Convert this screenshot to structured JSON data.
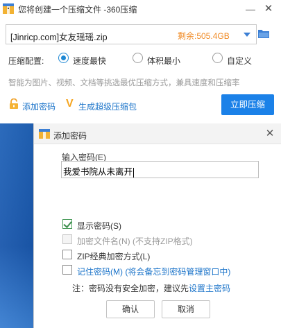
{
  "main_window": {
    "title": "您将创建一个压缩文件 -360压缩",
    "min_icon": "—",
    "close_icon": "✕",
    "path_value": "[Jinricp.com]女友瑶瑶.zip",
    "free_space": "剩余:505.4GB",
    "config_label": "压缩配置:",
    "options": [
      {
        "label": "速度最快",
        "selected": true
      },
      {
        "label": "体积最小",
        "selected": false
      },
      {
        "label": "自定义",
        "selected": false
      }
    ],
    "hint": "智能为图片、视频、文档等挑选最优压缩方式，兼具速度和压缩率",
    "add_password_link": "添加密码",
    "super_icon": "V",
    "super_package_link": "生成超级压缩包",
    "compress_button": "立即压缩"
  },
  "dialog": {
    "title": "添加密码",
    "close_icon": "✕",
    "password_label": "输入密码(E)",
    "password_value": "我爱书院从未离开",
    "checkboxes": [
      {
        "label": "显示密码(S)",
        "checked": true,
        "disabled": false
      },
      {
        "label": "加密文件名(N) (不支持ZIP格式)",
        "checked": false,
        "disabled": true
      },
      {
        "label": "ZIP经典加密方式(L)",
        "checked": false,
        "disabled": false
      },
      {
        "label": "记住密码(M) (将会备忘到密码管理窗口中)",
        "checked": false,
        "disabled": false
      }
    ],
    "note_prefix": "注：密码没有安全加密，建议先",
    "note_link": "设置主密码",
    "ok_button": "确认",
    "cancel_button": "取消"
  },
  "colors": {
    "accent": "#1b81e8",
    "link": "#1a73c9",
    "free_space": "#f08a24",
    "desktop": "#2163b8"
  }
}
